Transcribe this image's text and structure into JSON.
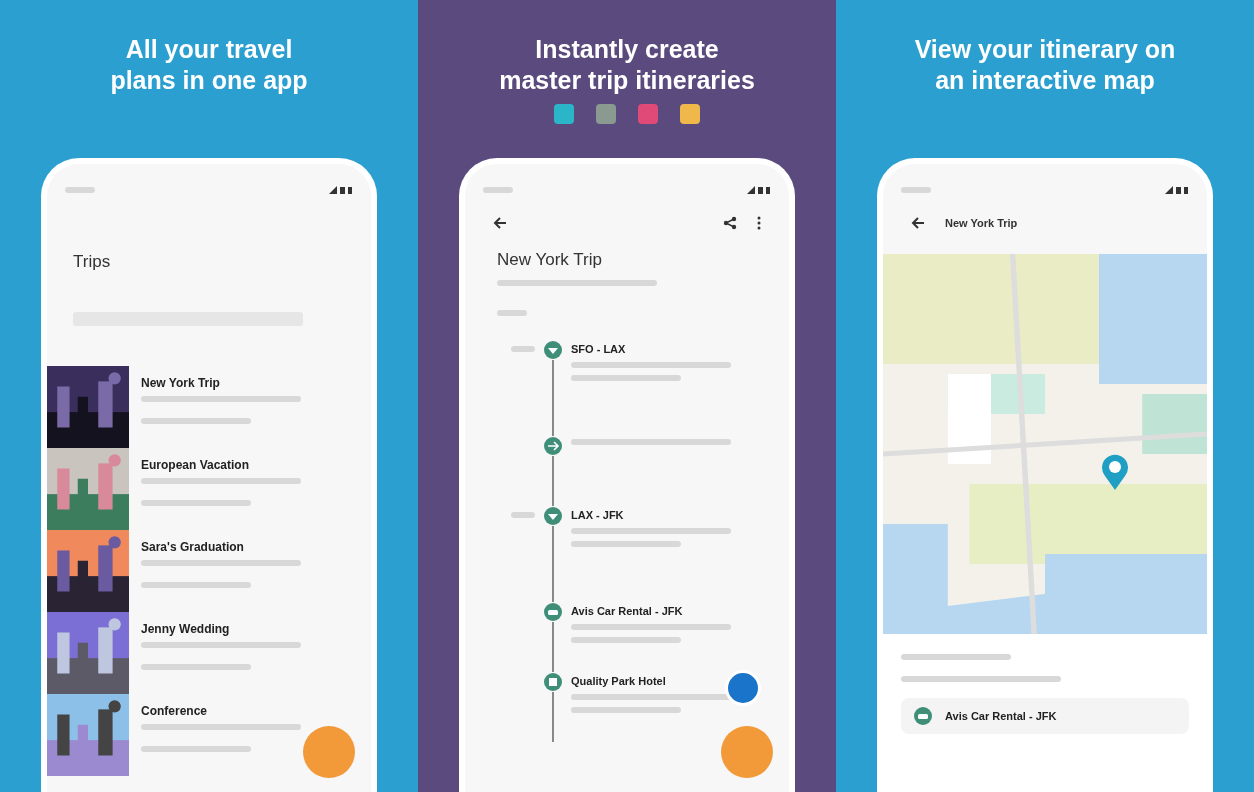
{
  "panels": [
    {
      "kind": "list",
      "headline": [
        "All your travel",
        "plans in one app"
      ],
      "screen": {
        "title": "Trips",
        "trips": [
          {
            "name": "New York Trip"
          },
          {
            "name": "European Vacation"
          },
          {
            "name": "Sara's Graduation"
          },
          {
            "name": "Jenny Wedding"
          },
          {
            "name": "Conference"
          }
        ]
      }
    },
    {
      "kind": "timeline",
      "headline": [
        "Instantly create",
        "master trip itineraries"
      ],
      "screen": {
        "title": "New York Trip",
        "events": [
          {
            "kind": "flight",
            "title": "SFO - LAX"
          },
          {
            "kind": "transfer"
          },
          {
            "kind": "flight",
            "title": "LAX - JFK"
          },
          {
            "kind": "car",
            "title": "Avis Car Rental - JFK"
          },
          {
            "kind": "hotel",
            "title": "Quality Park Hotel"
          }
        ]
      }
    },
    {
      "kind": "map",
      "headline": [
        "View your itinerary on",
        "an interactive map"
      ],
      "screen": {
        "title": "New York Trip",
        "card": "Avis Car Rental - JFK"
      }
    }
  ]
}
